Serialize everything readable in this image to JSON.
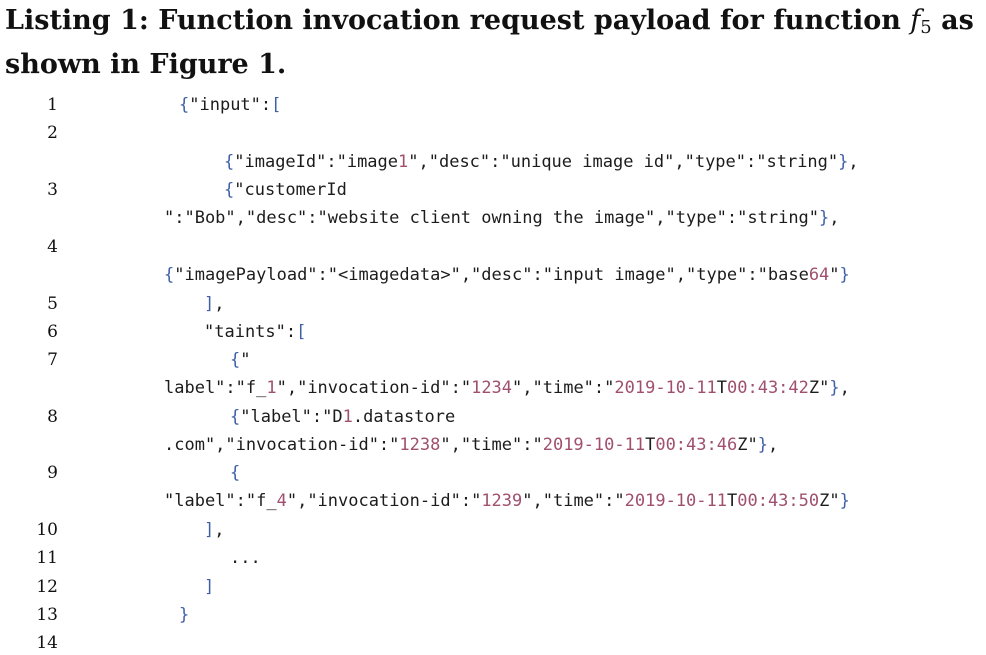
{
  "caption": {
    "prefix": "Listing 1: Function invocation request payload for function ",
    "fn": "f",
    "fn_sub": "5",
    "suffix": " as shown in Figure 1."
  },
  "line_numbers": [
    "1",
    "2",
    "3",
    "4",
    "5",
    "6",
    "7",
    "8",
    "9",
    "10",
    "11",
    "12",
    "13",
    "14"
  ],
  "code_lines": [
    [
      {
        "t": "{",
        "c": "p"
      },
      {
        "t": "\"input\":"
      },
      {
        "t": "[",
        "c": "p"
      }
    ],
    [
      {
        "t": "{",
        "c": "p"
      },
      {
        "t": "\"imageId\":\"image"
      },
      {
        "t": "1",
        "c": "n"
      },
      {
        "t": "\",\"desc\":\"unique image id\",\"type\":\"string\""
      },
      {
        "t": "}",
        "c": "p"
      },
      {
        "t": ","
      }
    ],
    [
      {
        "t": "{",
        "c": "p"
      },
      {
        "t": "\"customerId"
      }
    ],
    [
      {
        "t": "\":\"Bob\",\"desc\":\"website client owning the image\",\"type\":\"string\""
      },
      {
        "t": "}",
        "c": "p"
      },
      {
        "t": ","
      }
    ],
    [
      {
        "t": "{",
        "c": "p"
      },
      {
        "t": "\"imagePayload\":\"<imagedata>\",\"desc\":\"input image\",\"type\":\"base"
      },
      {
        "t": "64",
        "c": "n"
      },
      {
        "t": "\""
      },
      {
        "t": "}",
        "c": "p"
      }
    ],
    [
      {
        "t": "]",
        "c": "p"
      },
      {
        "t": ","
      }
    ],
    [
      {
        "t": "\"taints\":"
      },
      {
        "t": "[",
        "c": "p"
      }
    ],
    [
      {
        "t": "{",
        "c": "p"
      },
      {
        "t": "\""
      }
    ],
    [
      {
        "t": "label\":\"f_"
      },
      {
        "t": "1",
        "c": "n"
      },
      {
        "t": "\",\"invocation-id\":\""
      },
      {
        "t": "1234",
        "c": "n"
      },
      {
        "t": "\",\"time\":\""
      },
      {
        "t": "2019-10-11",
        "c": "n"
      },
      {
        "t": "T"
      },
      {
        "t": "00:43:42",
        "c": "n"
      },
      {
        "t": "Z\""
      },
      {
        "t": "}",
        "c": "p"
      },
      {
        "t": ","
      }
    ],
    [
      {
        "t": "{",
        "c": "p"
      },
      {
        "t": "\"label\":\"D"
      },
      {
        "t": "1",
        "c": "n"
      },
      {
        "t": ".datastore"
      }
    ],
    [
      {
        "t": ".com\",\"invocation-id\":\""
      },
      {
        "t": "1238",
        "c": "n"
      },
      {
        "t": "\",\"time\":\""
      },
      {
        "t": "2019-10-11",
        "c": "n"
      },
      {
        "t": "T"
      },
      {
        "t": "00:43:46",
        "c": "n"
      },
      {
        "t": "Z\""
      },
      {
        "t": "}",
        "c": "p"
      },
      {
        "t": ","
      }
    ],
    [
      {
        "t": "{",
        "c": "p"
      }
    ],
    [
      {
        "t": "\"label\":\"f_"
      },
      {
        "t": "4",
        "c": "n"
      },
      {
        "t": "\",\"invocation-id\":\""
      },
      {
        "t": "1239",
        "c": "n"
      },
      {
        "t": "\",\"time\":\""
      },
      {
        "t": "2019-10-11",
        "c": "n"
      },
      {
        "t": "T"
      },
      {
        "t": "00:43:50",
        "c": "n"
      },
      {
        "t": "Z\""
      },
      {
        "t": "}",
        "c": "p"
      }
    ],
    [
      {
        "t": "]",
        "c": "p"
      },
      {
        "t": ","
      }
    ],
    [
      {
        "t": "..."
      }
    ],
    [
      {
        "t": "]",
        "c": "p"
      }
    ],
    [
      {
        "t": "}",
        "c": "p"
      }
    ]
  ]
}
